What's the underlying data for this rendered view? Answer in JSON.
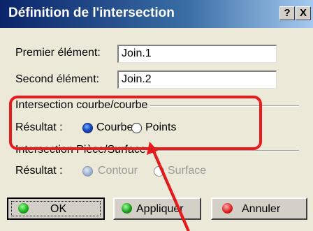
{
  "window": {
    "title": "Définition de l'intersection",
    "help_label": "?",
    "close_label": "X"
  },
  "fields": {
    "first_label": "Premier élément:",
    "first_value": "Join.1",
    "second_label": "Second élément:",
    "second_value": "Join.2"
  },
  "curve_group": {
    "title": "Intersection courbe/courbe",
    "result_label": "Résultat :",
    "option1": "Courbe",
    "option2": "Points",
    "selected": "Courbe"
  },
  "part_group": {
    "title": "Intersection Pièce/Surface",
    "result_label": "Résultat :",
    "option1": "Contour",
    "option2": "Surface",
    "selected": "Contour",
    "enabled": false
  },
  "buttons": {
    "ok": "OK",
    "apply": "Appliquer",
    "cancel": "Annuler"
  },
  "colors": {
    "highlight": "#e81c1c",
    "title_bar": "#0a246a",
    "dialog_bg": "#ece9d8"
  }
}
